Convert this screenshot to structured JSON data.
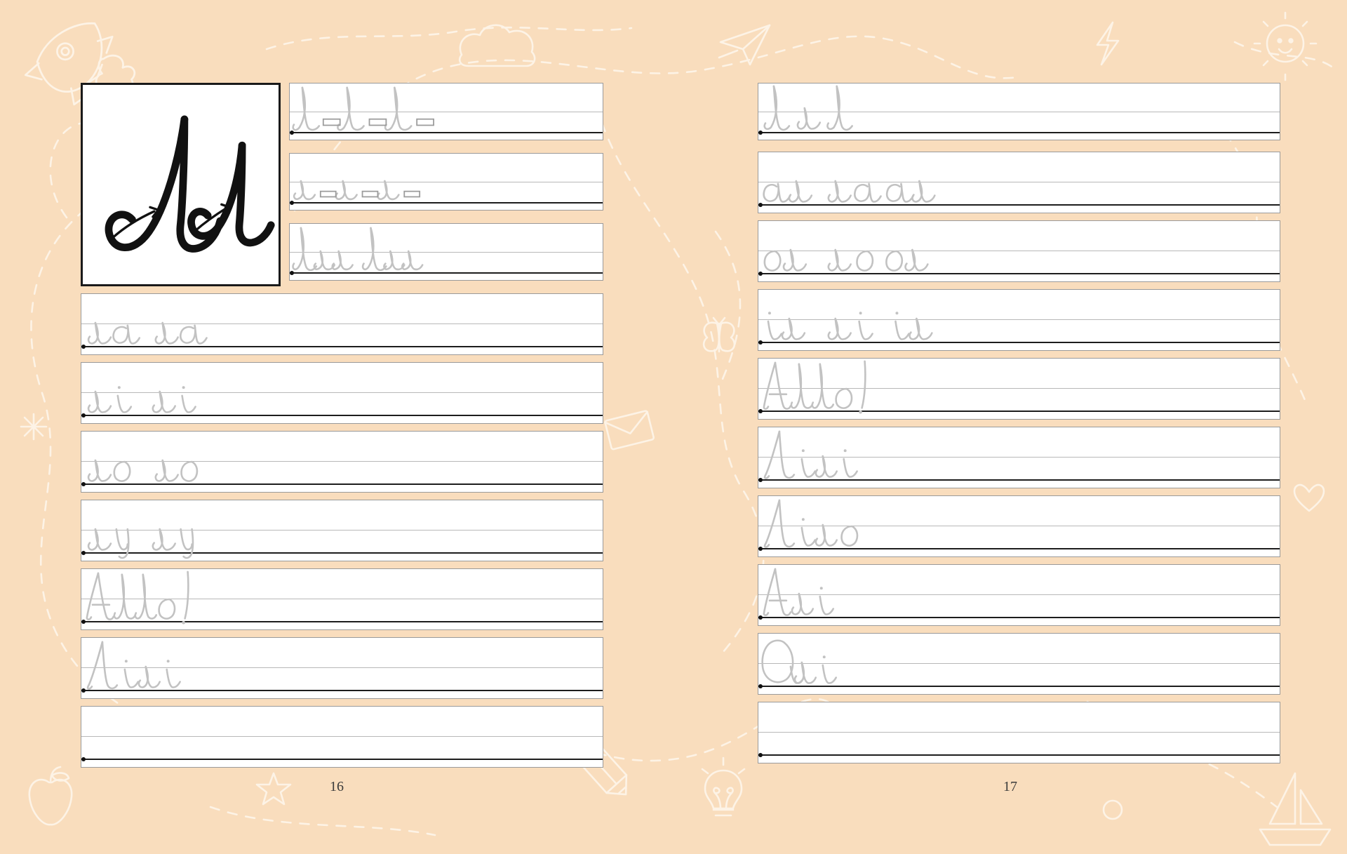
{
  "book": {
    "type": "cursive-handwriting-workbook",
    "language": "Ukrainian",
    "letter": "Лл",
    "letter_uppercase": "Л",
    "letter_lowercase": "л",
    "background_color": "#f9ddbd",
    "trace_color": "#c2c2c2",
    "baseline_color": "#1d1d1d",
    "rule_color": "#b8b8b8",
    "card_border_color": "#1a1a1a"
  },
  "left_page": {
    "page_number": "16",
    "letter_card": {
      "label": "Лл",
      "uppercase": "Л",
      "lowercase": "л",
      "has_stroke_arrows": true,
      "arrow_count": 2
    },
    "top_rows": [
      {
        "index": 1,
        "text": "Л Л Л",
        "pattern": "Л__Л__Л__",
        "has_spacer_boxes": true,
        "spacer_count": 3,
        "case": "uppercase"
      },
      {
        "index": 2,
        "text": "л л л",
        "pattern": "л__л__л__",
        "has_spacer_boxes": true,
        "spacer_count": 3,
        "case": "lowercase"
      },
      {
        "index": 3,
        "text": "Лл Лл",
        "pattern": "Лл Лл",
        "has_spacer_boxes": false,
        "case": "mixed"
      }
    ],
    "full_rows": [
      {
        "index": 4,
        "text": "ла ла",
        "kind": "syllable"
      },
      {
        "index": 5,
        "text": "лі лі",
        "kind": "syllable"
      },
      {
        "index": 6,
        "text": "ло ло",
        "kind": "syllable"
      },
      {
        "index": 7,
        "text": "лу лу",
        "kind": "syllable"
      },
      {
        "index": 8,
        "text": "Алло!",
        "kind": "word"
      },
      {
        "index": 9,
        "text": "Лілі",
        "kind": "word"
      },
      {
        "index": 10,
        "text": "",
        "kind": "blank"
      }
    ]
  },
  "right_page": {
    "page_number": "17",
    "rows": [
      {
        "index": 1,
        "text": "Л л Л",
        "kind": "letters"
      },
      {
        "index": 2,
        "text": "ал ла ал",
        "kind": "syllable"
      },
      {
        "index": 3,
        "text": "ол ло ол",
        "kind": "syllable"
      },
      {
        "index": 4,
        "text": "іл лі іл",
        "kind": "syllable"
      },
      {
        "index": 5,
        "text": "Алло!",
        "kind": "word"
      },
      {
        "index": 6,
        "text": "Лілі",
        "kind": "word"
      },
      {
        "index": 7,
        "text": "Ліло",
        "kind": "word"
      },
      {
        "index": 8,
        "text": "Алі",
        "kind": "word"
      },
      {
        "index": 9,
        "text": "Олі",
        "kind": "word"
      },
      {
        "index": 10,
        "text": "",
        "kind": "blank"
      }
    ]
  },
  "decorations": [
    {
      "name": "rocket-doodle",
      "position": "top-left"
    },
    {
      "name": "cloud-doodle",
      "position": "top-center-left"
    },
    {
      "name": "paper-plane-doodle",
      "position": "top-center"
    },
    {
      "name": "lightning-doodle",
      "position": "top-right"
    },
    {
      "name": "sun-doodle",
      "position": "top-right-corner"
    },
    {
      "name": "butterfly-doodle",
      "position": "middle-center"
    },
    {
      "name": "envelope-doodle",
      "position": "middle-center-lower"
    },
    {
      "name": "sparkle-doodle",
      "position": "middle-left"
    },
    {
      "name": "heart-doodle",
      "position": "middle-right"
    },
    {
      "name": "apple-doodle",
      "position": "bottom-left"
    },
    {
      "name": "star-doodle",
      "position": "bottom-left-center"
    },
    {
      "name": "pencil-doodle",
      "position": "bottom-center"
    },
    {
      "name": "lightbulb-doodle",
      "position": "bottom-center-right"
    },
    {
      "name": "circle-doodle",
      "position": "bottom-right-center"
    },
    {
      "name": "sailboat-doodle",
      "position": "bottom-right"
    },
    {
      "name": "dashed-path",
      "position": "full-spread"
    }
  ]
}
